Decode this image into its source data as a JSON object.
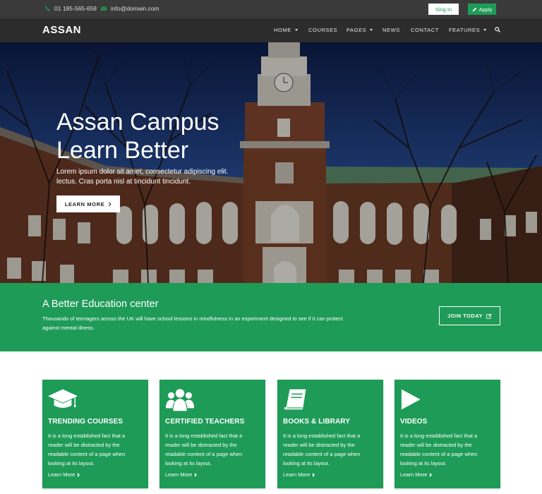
{
  "topbar": {
    "phone": "01 185-565-658",
    "email": "info@domain.com",
    "signin_label": "Sing In",
    "apply_label": "Apply"
  },
  "navbar": {
    "logo": "ASSAN",
    "items": [
      {
        "label": "HOME",
        "dropdown": true
      },
      {
        "label": "COURSES",
        "dropdown": false
      },
      {
        "label": "PAGES",
        "dropdown": true
      },
      {
        "label": "NEWS",
        "dropdown": false
      },
      {
        "label": "CONTACT",
        "dropdown": false
      },
      {
        "label": "FEATURES",
        "dropdown": true
      }
    ]
  },
  "hero": {
    "title_line1": "Assan Campus",
    "title_line2": "Learn Better",
    "subtitle": "Lorem ipsum dolor sit amet, consectetur adipiscing elit. lectus. Cras porta nisl at tincidunt tincidunt.",
    "button_label": "LEARN MORE"
  },
  "band": {
    "title": "A Better Education center",
    "text": "Thousands of teenagers across the UK will have school lessons in mindfulness in an experiment designed to see if it can protect against mental illness.",
    "button_label": "JOIN TODAY"
  },
  "features": [
    {
      "icon": "graduation-cap-icon",
      "title": "TRENDING COURSES",
      "text": "It is a long established fact that a reader will be distracted by the readable content of a page when looking at its layout.",
      "link": "Learn More"
    },
    {
      "icon": "users-icon",
      "title": "CERTIFIED TEACHERS",
      "text": "It is a long established fact that a reader will be distracted by the readable content of a page when looking at its layout.",
      "link": "Learn More"
    },
    {
      "icon": "book-icon",
      "title": "BOOKS & LIBRARY",
      "text": "It is a long established fact that a reader will be distracted by the readable content of a page when looking at its layout.",
      "link": "Learn More"
    },
    {
      "icon": "play-icon",
      "title": "VIDEOS",
      "text": "It is a long established fact that a reader will be distracted by the readable content of a page when looking at its layout.",
      "link": "Learn More"
    }
  ],
  "colors": {
    "accent": "#1e9b57",
    "topbar": "#3a3a3a",
    "navbar": "#2c2c2c"
  }
}
